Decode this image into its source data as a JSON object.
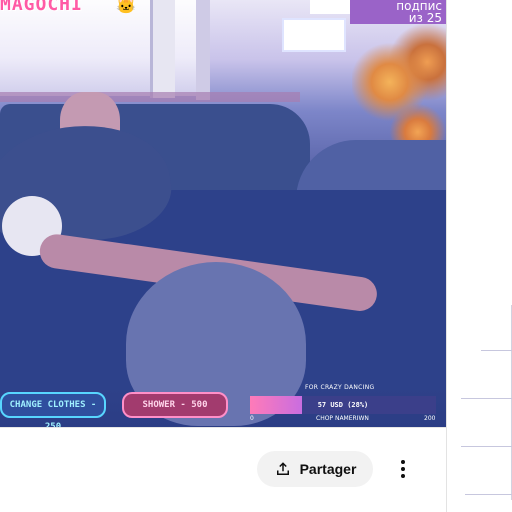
{
  "video": {
    "stream_title": "MAGOCHI",
    "subscriber_badge": {
      "line1": "подпис",
      "line2": "из 25"
    },
    "overlay_buttons": [
      {
        "label": "CHANGE CLOTHES - 250"
      },
      {
        "label": "SHOWER - 500"
      }
    ],
    "goal": {
      "title": "FOR CRAZY DANCING",
      "progress_text": "57 USD (28%)",
      "progress": 0.28,
      "min_label": "0",
      "sub_label": "CHOP NAMERIWN",
      "max_label": "200"
    }
  },
  "actions": {
    "share_label": "Partager"
  },
  "colors": {
    "share_bg": "#f2f2f2",
    "badge_bg": "#9a63c8",
    "pill_cyan": "#58d6ff",
    "pill_pink": "#ff8fc8"
  }
}
